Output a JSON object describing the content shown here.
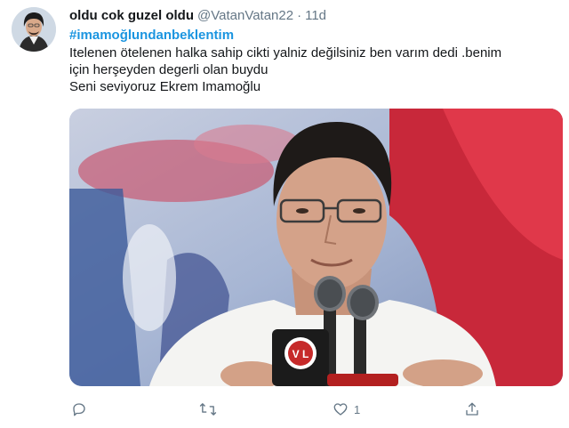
{
  "tweet": {
    "display_name": "oldu cok guzel oldu",
    "handle": "@VatanVatan22",
    "separator": "·",
    "time": "11d",
    "hashtag": "#imamoğlundanbeklentim",
    "body_lines": [
      "Itelenen ötelenen  halka sahip cikti yalniz değilsiniz ben varım dedi .benim",
      "için herşeyden degerli olan buydu",
      "Seni seviyoruz Ekrem Imamoğlu"
    ],
    "media": {
      "microphone_logo_text": "V  L"
    },
    "actions": {
      "reply_icon": "reply-icon",
      "retweet_icon": "retweet-icon",
      "like_icon": "heart-icon",
      "like_count": "1",
      "share_icon": "share-icon"
    }
  },
  "colors": {
    "text": "#14171a",
    "secondary_text": "#657786",
    "hashtag": "#1b95e0"
  }
}
